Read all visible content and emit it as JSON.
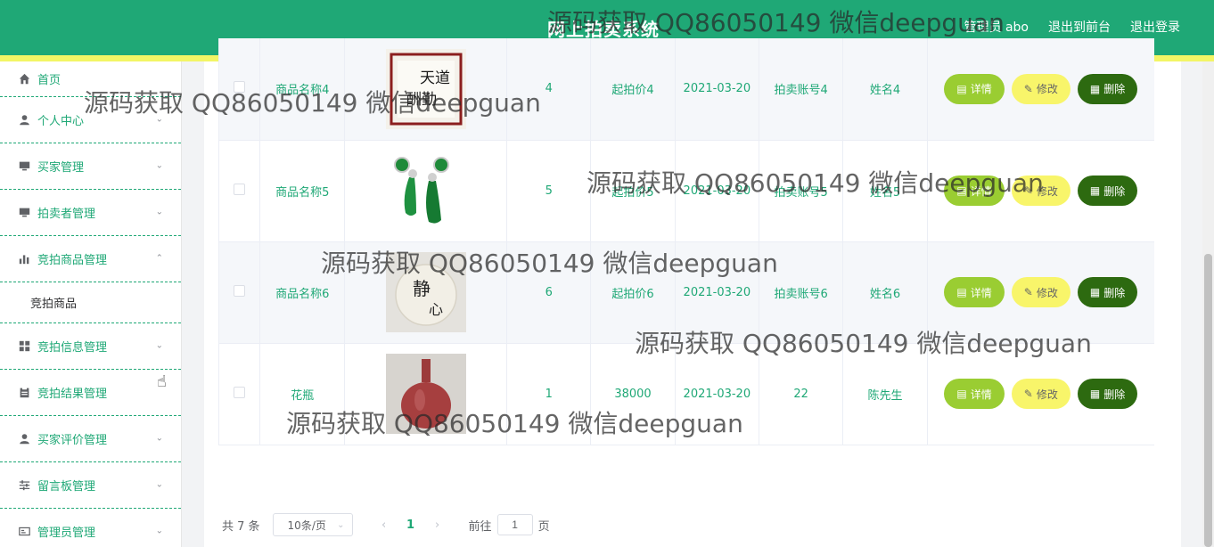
{
  "header": {
    "title": "网上拍卖系统",
    "links": [
      "管理员 abo",
      "退出到前台",
      "退出登录"
    ]
  },
  "sidebar": {
    "items": [
      {
        "label": "首页",
        "icon": "home-icon"
      },
      {
        "label": "个人中心",
        "icon": "user-icon"
      },
      {
        "label": "买家管理",
        "icon": "monitor-icon"
      },
      {
        "label": "拍卖者管理",
        "icon": "monitor-icon"
      },
      {
        "label": "竞拍商品管理",
        "icon": "bar-chart-icon"
      },
      {
        "label": "竞拍信息管理",
        "icon": "grid-icon"
      },
      {
        "label": "竞拍结果管理",
        "icon": "clipboard-icon"
      },
      {
        "label": "买家评价管理",
        "icon": "user-icon"
      },
      {
        "label": "留言板管理",
        "icon": "sliders-icon"
      },
      {
        "label": "管理员管理",
        "icon": "id-card-icon"
      }
    ],
    "submenu": [
      "竞拍商品"
    ]
  },
  "table": {
    "rows": [
      {
        "name": "商品名称4",
        "img": "calligraphy-painting-image",
        "num": "4",
        "price": "起拍价4",
        "date": "2021-03-20",
        "account": "拍卖账号4",
        "user": "姓名4"
      },
      {
        "name": "商品名称5",
        "img": "jade-jewelry-image",
        "num": "5",
        "price": "起拍价5",
        "date": "2021-03-20",
        "account": "拍卖账号5",
        "user": "姓名5"
      },
      {
        "name": "商品名称6",
        "img": "calligraphy-scroll-image",
        "num": "6",
        "price": "起拍价6",
        "date": "2021-03-20",
        "account": "拍卖账号6",
        "user": "姓名6"
      },
      {
        "name": "花瓶",
        "img": "red-vase-image",
        "num": "1",
        "price": "38000",
        "date": "2021-03-20",
        "account": "22",
        "user": "陈先生"
      }
    ],
    "actions": {
      "detail": "详情",
      "edit": "修改",
      "delete": "删除"
    }
  },
  "pagination": {
    "total": "共 7 条",
    "page_size": "10条/页",
    "current": "1",
    "goto_prefix": "前往",
    "goto_value": "1",
    "goto_suffix": "页"
  },
  "watermark": "源码获取 QQ86050149 微信deepguan",
  "colors": {
    "primary": "#1fa876",
    "accent_strip": "#f3f565",
    "detail": "#9acd32",
    "edit": "#f8f56a",
    "delete": "#2d6a10"
  }
}
